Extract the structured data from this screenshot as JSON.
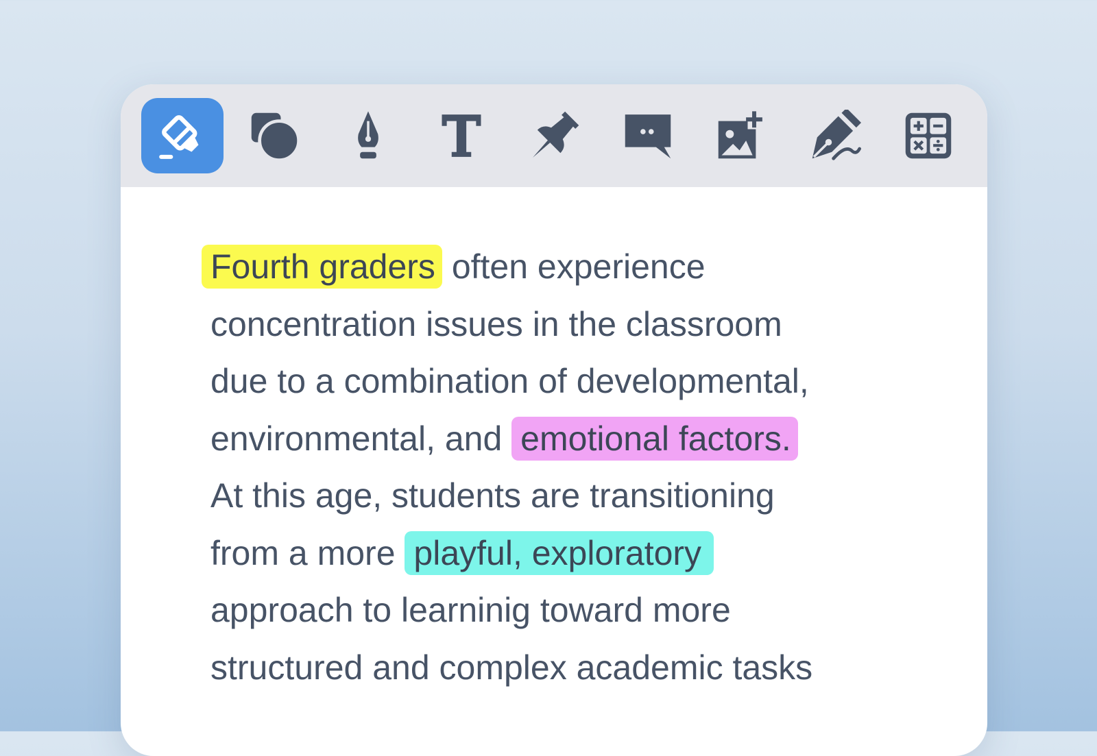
{
  "toolbar": {
    "tools": [
      {
        "name": "highlighter",
        "icon": "highlighter-icon",
        "active": true
      },
      {
        "name": "shapes",
        "icon": "shapes-icon",
        "active": false
      },
      {
        "name": "pen",
        "icon": "pen-nib-icon",
        "active": false
      },
      {
        "name": "text",
        "icon": "text-icon",
        "active": false
      },
      {
        "name": "pin",
        "icon": "pushpin-icon",
        "active": false
      },
      {
        "name": "comment",
        "icon": "comment-icon",
        "active": false
      },
      {
        "name": "add-image",
        "icon": "image-add-icon",
        "active": false
      },
      {
        "name": "signature",
        "icon": "signature-pen-icon",
        "active": false
      },
      {
        "name": "calculator",
        "icon": "calculator-icon",
        "active": false
      }
    ],
    "active_color": "#4a90e2",
    "icon_color": "#475366"
  },
  "document": {
    "line1": {
      "highlight": "Fourth graders",
      "rest": " often experience"
    },
    "line2": "concentration issues in the classroom",
    "line3": "due to a combination of developmental,",
    "line4": {
      "before": "environmental, and ",
      "highlight": "emotional factors."
    },
    "line5": "At this age, students are transitioning",
    "line6": {
      "before": "from a more ",
      "highlight": "playful, exploratory"
    },
    "line7": "approach to learninig toward more",
    "line8": "structured and complex academic tasks",
    "highlight_colors": {
      "yellow": "#fbfa4f",
      "pink": "#f1a4f5",
      "cyan": "#7df5ea"
    }
  }
}
